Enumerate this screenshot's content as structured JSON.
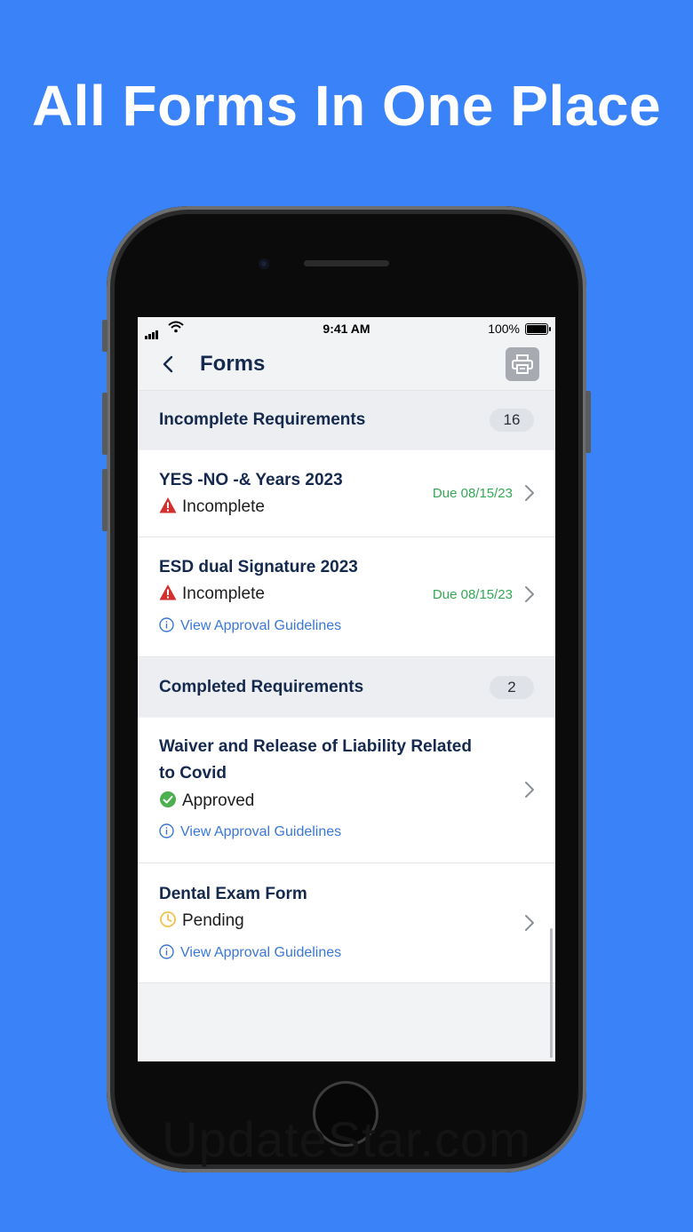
{
  "headline": "All Forms In One Place",
  "watermark": "UpdateStar.com",
  "status_bar": {
    "time": "9:41 AM",
    "battery": "100%"
  },
  "nav": {
    "title": "Forms",
    "back_icon": "chevron-left-icon",
    "print_icon": "printer-icon"
  },
  "sections": [
    {
      "title": "Incomplete Requirements",
      "count": "16"
    },
    {
      "title": "Completed Requirements",
      "count": "2"
    }
  ],
  "forms": [
    {
      "title": "YES -NO -& Years 2023",
      "status": "Incomplete",
      "status_icon": "warning-icon",
      "due": "Due 08/15/23"
    },
    {
      "title": "ESD dual Signature 2023",
      "status": "Incomplete",
      "status_icon": "warning-icon",
      "due": "Due 08/15/23",
      "link": "View Approval Guidelines"
    },
    {
      "title_line1": "Waiver and Release of Liability Related",
      "title_line2": "to Covid",
      "status": "Approved",
      "status_icon": "check-circle-icon",
      "link": "View Approval Guidelines"
    },
    {
      "title": "Dental Exam Form",
      "status": "Pending",
      "status_icon": "clock-icon",
      "link": "View Approval Guidelines"
    }
  ],
  "colors": {
    "background": "#3a82f7",
    "navy": "#14294d",
    "due_green": "#34a853",
    "link_blue": "#3a78d8",
    "warning_red": "#d32f2f",
    "approved_green": "#4caf50",
    "pending_yellow": "#f2c14e"
  }
}
